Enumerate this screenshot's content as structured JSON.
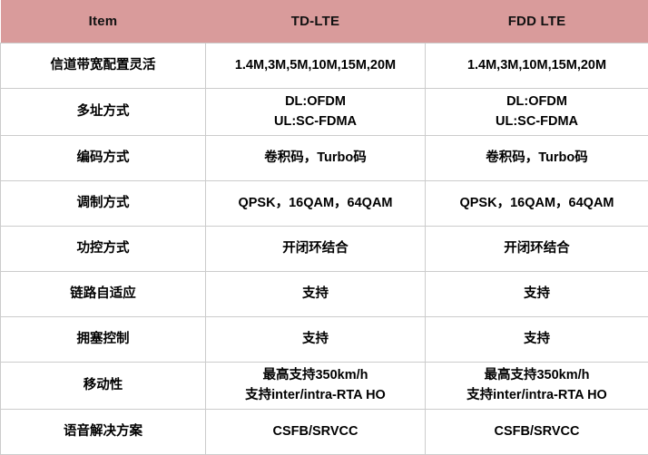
{
  "table": {
    "headers": [
      {
        "label": "Item",
        "name": "header-item"
      },
      {
        "label": "TD-LTE",
        "name": "header-td-lte"
      },
      {
        "label": "FDD LTE",
        "name": "header-fdd-lte"
      }
    ],
    "header_background": "#d99b9b",
    "border_color": "#cccccc",
    "rows": [
      {
        "item": "信道带宽配置灵活",
        "td_lte": [
          "1.4M,3M,5M,10M,15M,20M"
        ],
        "fdd_lte": [
          "1.4M,3M,10M,15M,20M"
        ]
      },
      {
        "item": "多址方式",
        "td_lte": [
          "DL:OFDM",
          "UL:SC-FDMA"
        ],
        "fdd_lte": [
          "DL:OFDM",
          "UL:SC-FDMA"
        ]
      },
      {
        "item": "编码方式",
        "td_lte": [
          "卷积码，Turbo码"
        ],
        "fdd_lte": [
          "卷积码，Turbo码"
        ]
      },
      {
        "item": "调制方式",
        "td_lte": [
          "QPSK，16QAM，64QAM"
        ],
        "fdd_lte": [
          "QPSK，16QAM，64QAM"
        ]
      },
      {
        "item": "功控方式",
        "td_lte": [
          "开闭环结合"
        ],
        "fdd_lte": [
          "开闭环结合"
        ]
      },
      {
        "item": "链路自适应",
        "td_lte": [
          "支持"
        ],
        "fdd_lte": [
          "支持"
        ]
      },
      {
        "item": "拥塞控制",
        "td_lte": [
          "支持"
        ],
        "fdd_lte": [
          "支持"
        ]
      },
      {
        "item": "移动性",
        "td_lte": [
          "最高支持350km/h",
          "支持inter/intra-RTA HO"
        ],
        "fdd_lte": [
          "最高支持350km/h",
          "支持inter/intra-RTA HO"
        ]
      },
      {
        "item": "语音解决方案",
        "td_lte": [
          "CSFB/SRVCC"
        ],
        "fdd_lte": [
          "CSFB/SRVCC"
        ]
      }
    ]
  }
}
